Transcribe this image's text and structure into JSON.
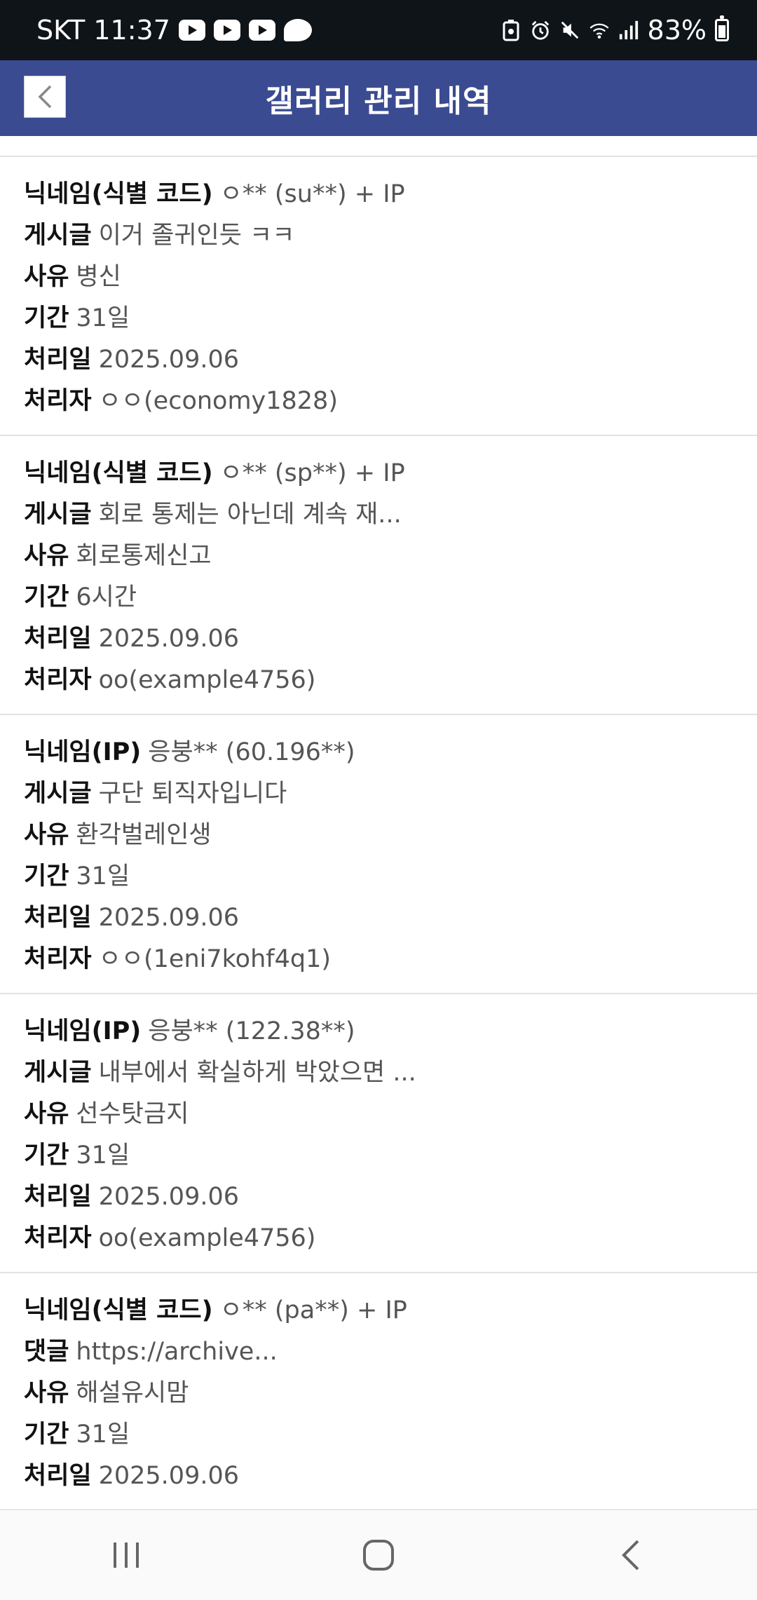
{
  "status_bar": {
    "carrier_time": "SKT 11:37",
    "battery": "83%",
    "battery_level": 0.83
  },
  "header": {
    "title": "갤러리 관리 내역"
  },
  "entries": [
    {
      "fields": [
        {
          "label": "닉네임(식별 코드)",
          "value": "ㅇ** (su**) + IP"
        },
        {
          "label": "게시글",
          "value": "이거 졸귀인듯 ㅋㅋ"
        },
        {
          "label": "사유",
          "value": "병신"
        },
        {
          "label": "기간",
          "value": "31일"
        },
        {
          "label": "처리일",
          "value": "2025.09.06"
        },
        {
          "label": "처리자",
          "value": "ㅇㅇ(economy1828)"
        }
      ]
    },
    {
      "fields": [
        {
          "label": "닉네임(식별 코드)",
          "value": "ㅇ** (sp**) + IP"
        },
        {
          "label": "게시글",
          "value": "회로 통제는 아닌데 계속 재..."
        },
        {
          "label": "사유",
          "value": "회로통제신고"
        },
        {
          "label": "기간",
          "value": "6시간"
        },
        {
          "label": "처리일",
          "value": "2025.09.06"
        },
        {
          "label": "처리자",
          "value": "oo(example4756)"
        }
      ]
    },
    {
      "fields": [
        {
          "label": "닉네임(IP)",
          "value": "응붕** (60.196**)"
        },
        {
          "label": "게시글",
          "value": "구단 퇴직자입니다"
        },
        {
          "label": "사유",
          "value": "환각벌레인생"
        },
        {
          "label": "기간",
          "value": "31일"
        },
        {
          "label": "처리일",
          "value": "2025.09.06"
        },
        {
          "label": "처리자",
          "value": "ㅇㅇ(1eni7kohf4q1)"
        }
      ]
    },
    {
      "fields": [
        {
          "label": "닉네임(IP)",
          "value": "응붕** (122.38**)"
        },
        {
          "label": "게시글",
          "value": "내부에서 확실하게 박았으면 ..."
        },
        {
          "label": "사유",
          "value": "선수탓금지"
        },
        {
          "label": "기간",
          "value": "31일"
        },
        {
          "label": "처리일",
          "value": "2025.09.06"
        },
        {
          "label": "처리자",
          "value": "oo(example4756)"
        }
      ]
    },
    {
      "fields": [
        {
          "label": "닉네임(식별 코드)",
          "value": "ㅇ** (pa**) + IP"
        },
        {
          "label": "댓글",
          "value": "https://archive..."
        },
        {
          "label": "사유",
          "value": "해설유시맘"
        },
        {
          "label": "기간",
          "value": "31일"
        },
        {
          "label": "처리일",
          "value": "2025.09.06"
        }
      ]
    }
  ],
  "icons": {
    "status_left": [
      "youtube-icon",
      "youtube-icon",
      "youtube-icon",
      "cloud-icon"
    ],
    "status_right": [
      "battery-saver-icon",
      "alarm-icon",
      "mute-icon",
      "wifi-icon",
      "signal-icon",
      "battery-icon"
    ],
    "nav": [
      "recent-apps-icon",
      "home-icon",
      "back-icon"
    ]
  }
}
